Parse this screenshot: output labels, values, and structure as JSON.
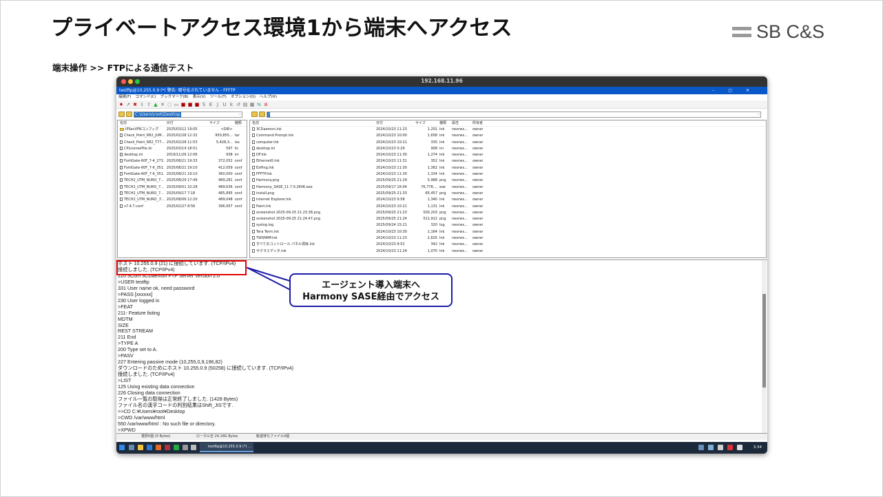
{
  "slide": {
    "title": "プライベートアクセス環境1から端末へアクセス",
    "subtitle": "端末操作 >> FTPによる通信テスト",
    "logo": "SB C&S"
  },
  "mac_window": {
    "title": "192.168.11.96"
  },
  "app": {
    "title": "testftp@10.255.0.9 (*) 警告: 暗号化されていません - FFFTP",
    "menu": [
      "接続(F)",
      "コマンド(C)",
      "ブックマーク(B)",
      "表示(V)",
      "ツール(T)",
      "オプション(O)",
      "ヘルプ(H)"
    ],
    "local_path": "C:\\Users\\root\\Desktop",
    "remote_path": "/",
    "local_headers": [
      "名前",
      "日付",
      "サイズ",
      "種類"
    ],
    "remote_headers": [
      "名前",
      "日付",
      "サイズ",
      "種類",
      "属性",
      "所有者"
    ],
    "local_files": [
      {
        "name": "IPSecVPNコンフィグ",
        "date": "2025/03/12 19:05",
        "size": "<DIR>",
        "type": "",
        "folder": true
      },
      {
        "name": "Check_Point_R82_JUM...",
        "date": "2025/02/28 12:32",
        "size": "950,855...",
        "type": "tar"
      },
      {
        "name": "Check_Point_R82_T77...",
        "date": "2025/02/28 11:53",
        "size": "5,428,3...",
        "type": "iso"
      },
      {
        "name": "CPLicenseFile.lic",
        "date": "2025/03/14 18:51",
        "size": "597",
        "type": "lic"
      },
      {
        "name": "desktop.ini",
        "date": "2019/11/26 12:06",
        "size": "938",
        "type": "ini"
      },
      {
        "name": "FortiGate-60F_7-4_273...",
        "date": "2025/08/21 19:33",
        "size": "372,052",
        "type": "conf"
      },
      {
        "name": "FortiGate-60F_7-6_351...",
        "date": "2025/08/21 19:10",
        "size": "412,059",
        "type": "conf"
      },
      {
        "name": "FortiGate-60F_7-6_351...",
        "date": "2025/08/21 19:10",
        "size": "360,000",
        "type": "conf"
      },
      {
        "name": "TECH2_UTM_NURO_7...",
        "date": "2025/08/29 17:49",
        "size": "489,281",
        "type": "conf"
      },
      {
        "name": "TECH2_UTM_NURO_7...",
        "date": "2025/09/01 10:28",
        "size": "489,636",
        "type": "conf"
      },
      {
        "name": "TECH2_UTM_NURO_7...",
        "date": "2025/09/17 7:18",
        "size": "485,895",
        "type": "conf"
      },
      {
        "name": "TECH2_UTM_NURO_ク...",
        "date": "2025/08/06 12:20",
        "size": "489,048",
        "type": "conf"
      },
      {
        "name": "v7.4.7.conf",
        "date": "2025/02/27 8:56",
        "size": "396,957",
        "type": "conf"
      }
    ],
    "remote_files": [
      {
        "name": "3CDaemon.lnk",
        "date": "2024/10/23 11:23",
        "size": "1,201",
        "type": "lnk",
        "attr": "rwxrwx...",
        "owner": "owner"
      },
      {
        "name": "Command Prompt.lnk",
        "date": "2024/10/23 10:00",
        "size": "1,658",
        "type": "lnk",
        "attr": "rwxrwx...",
        "owner": "owner"
      },
      {
        "name": "computer.lnk",
        "date": "2024/10/23 10:21",
        "size": "335",
        "type": "lnk",
        "attr": "rwxrwx...",
        "owner": "owner"
      },
      {
        "name": "desktop.ini",
        "date": "2024/10/23 0:29",
        "size": "908",
        "type": "ini",
        "attr": "rwxrwx...",
        "owner": "owner"
      },
      {
        "name": "DF.lnk",
        "date": "2024/10/23 11:30",
        "size": "1,274",
        "type": "lnk",
        "attr": "rwxrwx...",
        "owner": "owner"
      },
      {
        "name": "Ethernet0.lnk",
        "date": "2024/10/23 11:31",
        "size": "352",
        "type": "lnk",
        "attr": "rwxrwx...",
        "owner": "owner"
      },
      {
        "name": "ExPing.lnk",
        "date": "2024/10/23 11:30",
        "size": "1,362",
        "type": "lnk",
        "attr": "rwxrwx...",
        "owner": "owner"
      },
      {
        "name": "FFFTP.lnk",
        "date": "2024/10/23 11:30",
        "size": "1,334",
        "type": "lnk",
        "attr": "rwxrwx...",
        "owner": "owner"
      },
      {
        "name": "Harmony.png",
        "date": "2025/09/25 21:29",
        "size": "5,968",
        "type": "png",
        "attr": "rwxrwx...",
        "owner": "owner"
      },
      {
        "name": "Harmony_SASE_11.7.0.2606.exe",
        "date": "2025/09/17 16:04",
        "size": "76,778,...",
        "type": "exe",
        "attr": "rwxrwx...",
        "owner": "owner"
      },
      {
        "name": "install.png",
        "date": "2025/09/25 21:33",
        "size": "65,457",
        "type": "png",
        "attr": "rwxrwx...",
        "owner": "owner"
      },
      {
        "name": "Internet Explorer.lnk",
        "date": "2024/10/23 9:58",
        "size": "1,340",
        "type": "lnk",
        "attr": "rwxrwx...",
        "owner": "owner"
      },
      {
        "name": "Paint.lnk",
        "date": "2024/10/23 10:21",
        "size": "1,131",
        "type": "lnk",
        "attr": "rwxrwx...",
        "owner": "owner"
      },
      {
        "name": "screenshot 2025-09-25 21.23.38.png",
        "date": "2025/09/25 21:23",
        "size": "500,203",
        "type": "png",
        "attr": "rwxrwx...",
        "owner": "owner"
      },
      {
        "name": "screenshot 2025-09-25 21.24.47.png",
        "date": "2025/09/25 21:24",
        "size": "511,912",
        "type": "png",
        "attr": "rwxrwx...",
        "owner": "owner"
      },
      {
        "name": "syslog.log",
        "date": "2025/09/24 15:21",
        "size": "320",
        "type": "log",
        "attr": "rwxrwx...",
        "owner": "owner"
      },
      {
        "name": "Tera Term.lnk",
        "date": "2024/10/23 10:30",
        "size": "1,164",
        "type": "lnk",
        "attr": "rwxrwx...",
        "owner": "owner"
      },
      {
        "name": "TWSNMP.lnk",
        "date": "2024/10/23 11:23",
        "size": "2,625",
        "type": "lnk",
        "attr": "rwxrwx...",
        "owner": "owner"
      },
      {
        "name": "すべてのコントロール パネル項目.lnk",
        "date": "2024/10/23 9:52",
        "size": "342",
        "type": "lnk",
        "attr": "rwxrwx...",
        "owner": "owner"
      },
      {
        "name": "サクラエディタ.lnk",
        "date": "2024/10/23 11:24",
        "size": "1,070",
        "type": "lnk",
        "attr": "rwxrwx...",
        "owner": "owner"
      }
    ],
    "log": [
      "ホスト 10.255.0.9 (21) に接続しています. (TCP/IPv4)",
      "接続しました. (TCP/IPv4)",
      "220 3Com 3CDaemon FTP Server Version 2.0",
      ">USER testftp",
      "331 User name ok, need password",
      ">PASS [xxxxxx]",
      "230 User logged in",
      ">FEAT",
      "211- Feature listing",
      "MDTM",
      "SIZE",
      "REST STREAM",
      "211 End",
      ">TYPE A",
      "200 Type set to A.",
      ">PASV",
      "227 Entering passive mode (10,255,0,9,196,82)",
      "ダウンロードのためにホスト 10.255.0.9 (50258) に接続しています. (TCP/IPv4)",
      "接続しました. (TCP/IPv4)",
      ">LIST",
      "125 Using existing data connection",
      "226 Closing data connection",
      "ファイル一覧の取得は正常終了しました. (1428 Bytes)",
      "ファイル名の漢字コードの判別結果はShift_JISです.",
      ">>CD C:¥Users¥root¥Desktop",
      ">CWD /var/www/html",
      "550 /var/www/html : No such file or directory.",
      ">XPWD"
    ],
    "status": {
      "selected": "選択0個 (0 Bytes)",
      "local_free": "ローカル空 24.18G Bytes",
      "transfer": "転送待ちファイル0個"
    }
  },
  "taskbar": {
    "app_label": "testftp@10.255.0.9 (*) ...",
    "clock": "3:34"
  },
  "callout": {
    "line1": "エージェント導入端末へ",
    "line2": "Harmony SASE経由でアクセス"
  },
  "colors": {
    "highlight": "#e60000",
    "callout_border": "#1a1aa8",
    "titlebar": "#0a58c8",
    "selection": "#1565c0"
  }
}
